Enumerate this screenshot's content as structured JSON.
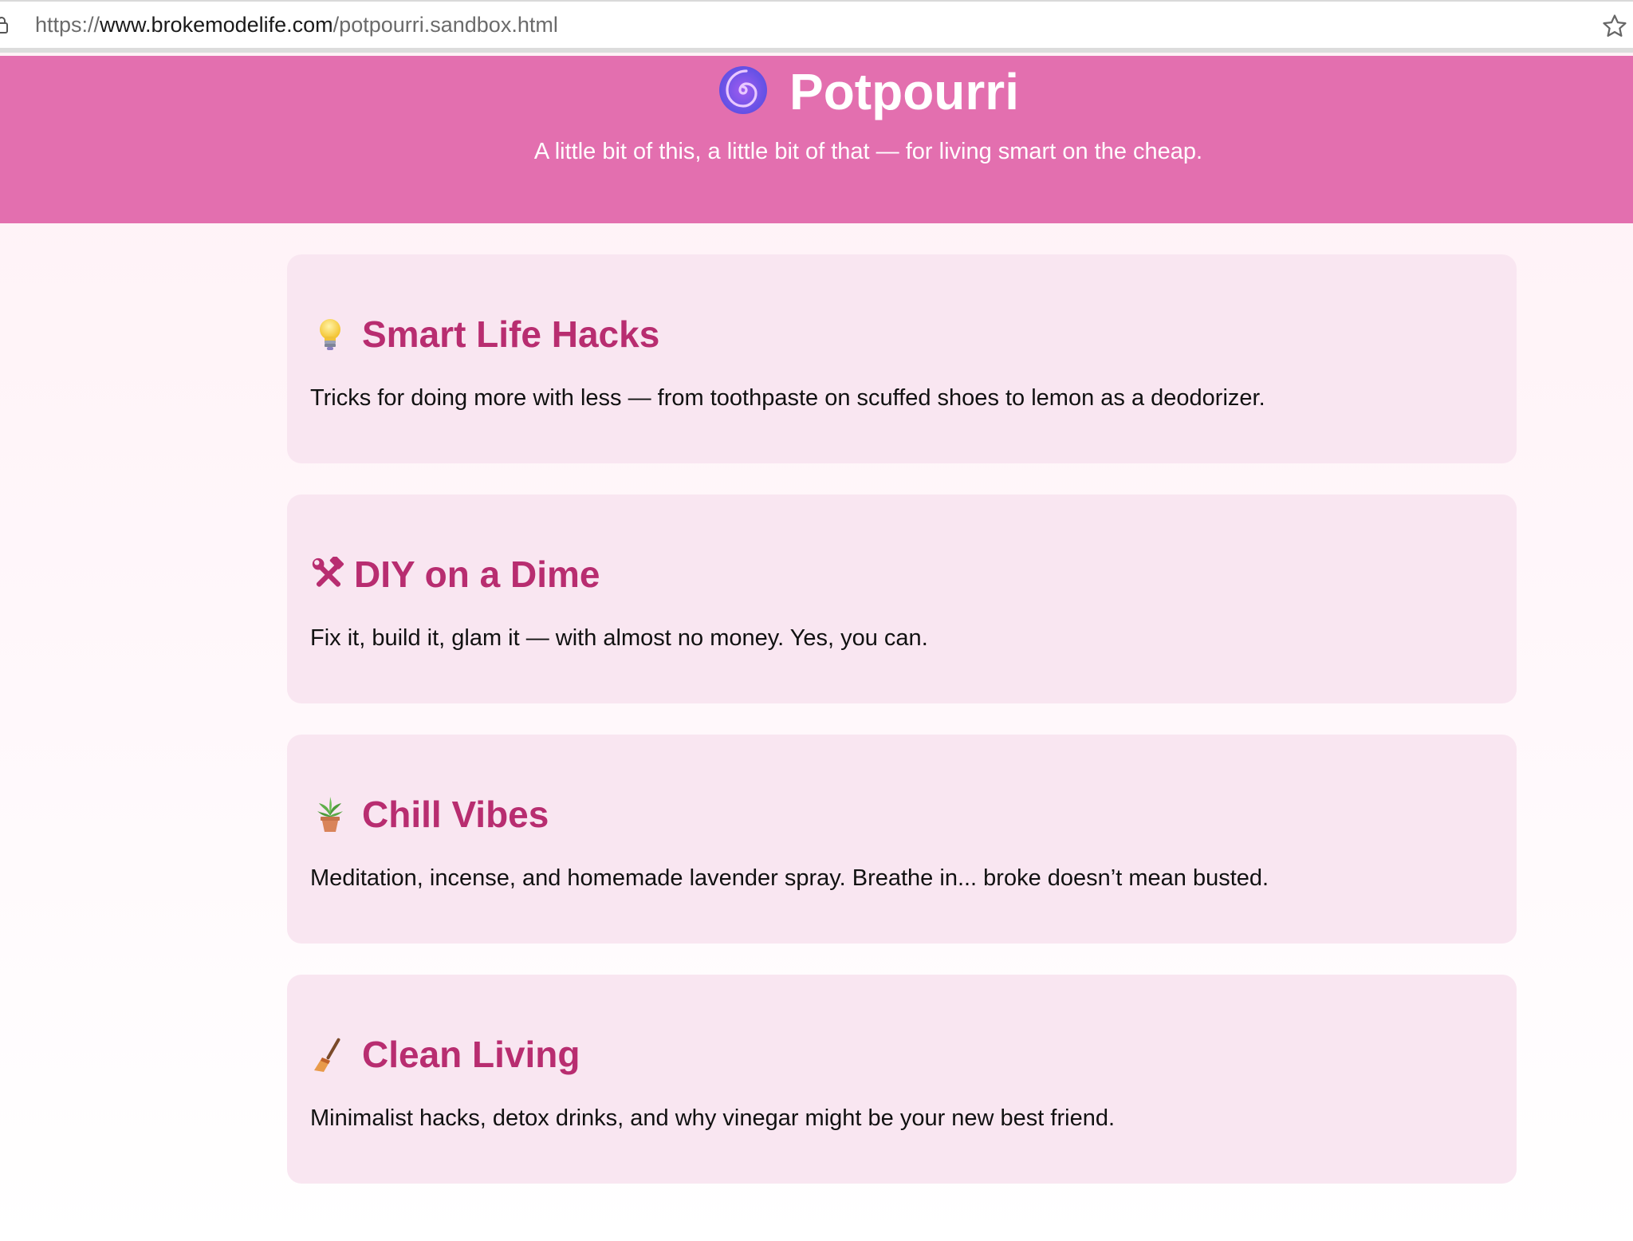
{
  "browser": {
    "url_scheme": "https://",
    "url_host": "www.brokemodelife.com",
    "url_path": "/potpourri.sandbox.html"
  },
  "hero": {
    "title": "Potpourri",
    "title_icon": "cyclone-swirl-icon",
    "subtitle": "A little bit of this, a little bit of that — for living smart on the cheap."
  },
  "cards": [
    {
      "icon": "light-bulb-icon",
      "title": "Smart Life Hacks",
      "text": "Tricks for doing more with less — from toothpaste on scuffed shoes to lemon as a deodorizer."
    },
    {
      "icon": "hammer-and-wrench-icon",
      "title": "DIY on a Dime",
      "text": "Fix it, build it, glam it — with almost no money. Yes, you can."
    },
    {
      "icon": "potted-plant-icon",
      "title": "Chill Vibes",
      "text": "Meditation, incense, and homemade lavender spray. Breathe in... broke doesn’t mean busted."
    },
    {
      "icon": "broom-icon",
      "title": "Clean Living",
      "text": "Minimalist hacks, detox drinks, and why vinegar might be your new best friend."
    }
  ],
  "colors": {
    "hero_background": "#e36faf",
    "card_background": "#f9e6f1",
    "card_title": "#b82d70"
  }
}
